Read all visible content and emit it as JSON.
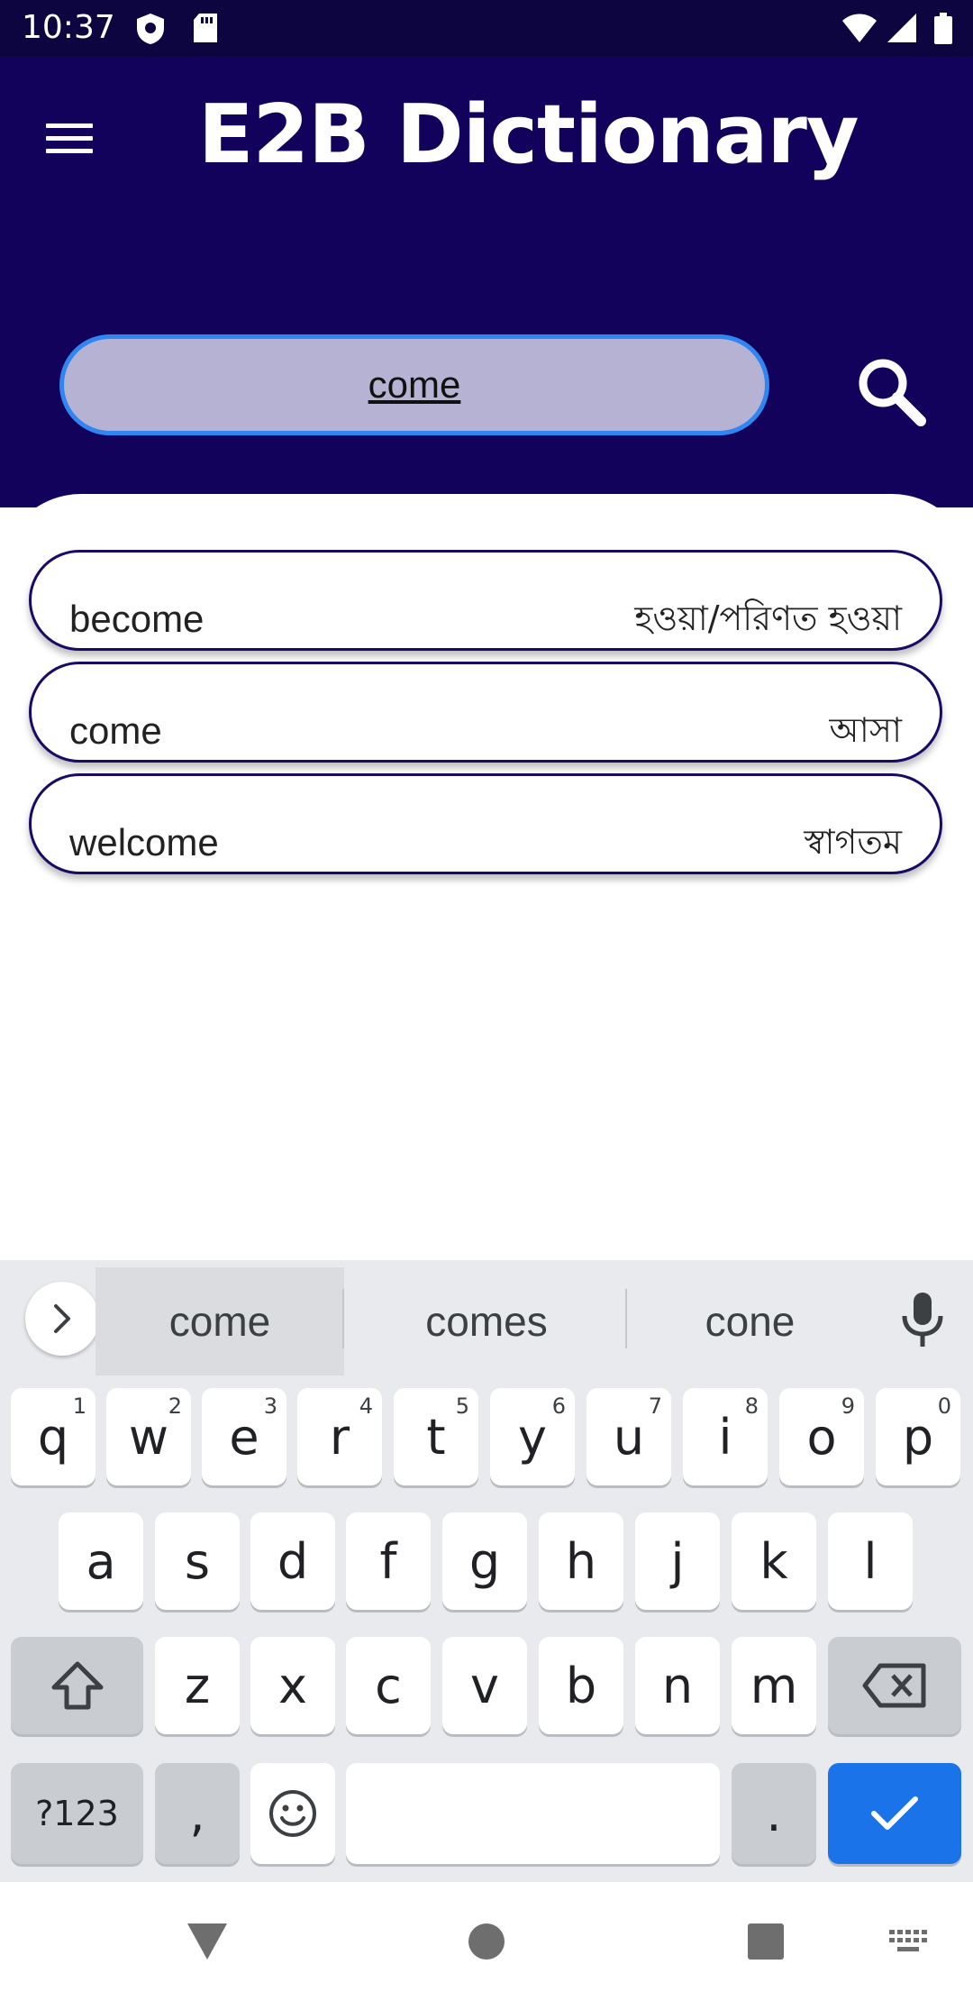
{
  "status_bar": {
    "time": "10:37",
    "left_icons": [
      "shield-icon",
      "sd-card-icon"
    ],
    "right_icons": [
      "wifi-icon",
      "signal-icon",
      "battery-icon"
    ]
  },
  "app": {
    "title": "E2B Dictionary",
    "header_color": "#13025c",
    "accent_color": "#2f86f0"
  },
  "search": {
    "value": "come",
    "button_icon": "search-icon"
  },
  "results": [
    {
      "word": "become",
      "meaning": "হওয়া/পরিণত হওয়া"
    },
    {
      "word": "come",
      "meaning": "আসা"
    },
    {
      "word": "welcome",
      "meaning": "স্বাগতম"
    }
  ],
  "keyboard": {
    "suggestions": [
      "come",
      "comes",
      "cone"
    ],
    "row1": [
      {
        "label": "q",
        "hint": "1"
      },
      {
        "label": "w",
        "hint": "2"
      },
      {
        "label": "e",
        "hint": "3"
      },
      {
        "label": "r",
        "hint": "4"
      },
      {
        "label": "t",
        "hint": "5"
      },
      {
        "label": "y",
        "hint": "6"
      },
      {
        "label": "u",
        "hint": "7"
      },
      {
        "label": "i",
        "hint": "8"
      },
      {
        "label": "o",
        "hint": "9"
      },
      {
        "label": "p",
        "hint": "0"
      }
    ],
    "row2": [
      "a",
      "s",
      "d",
      "f",
      "g",
      "h",
      "j",
      "k",
      "l"
    ],
    "row3": [
      "z",
      "x",
      "c",
      "v",
      "b",
      "n",
      "m"
    ],
    "symbols_label": "?123",
    "comma_label": ",",
    "period_label": ".",
    "enter_color": "#1a73e8"
  },
  "nav_bar": {
    "buttons": [
      "back-icon",
      "home-icon",
      "recents-icon",
      "keyboard-switch-icon"
    ]
  }
}
